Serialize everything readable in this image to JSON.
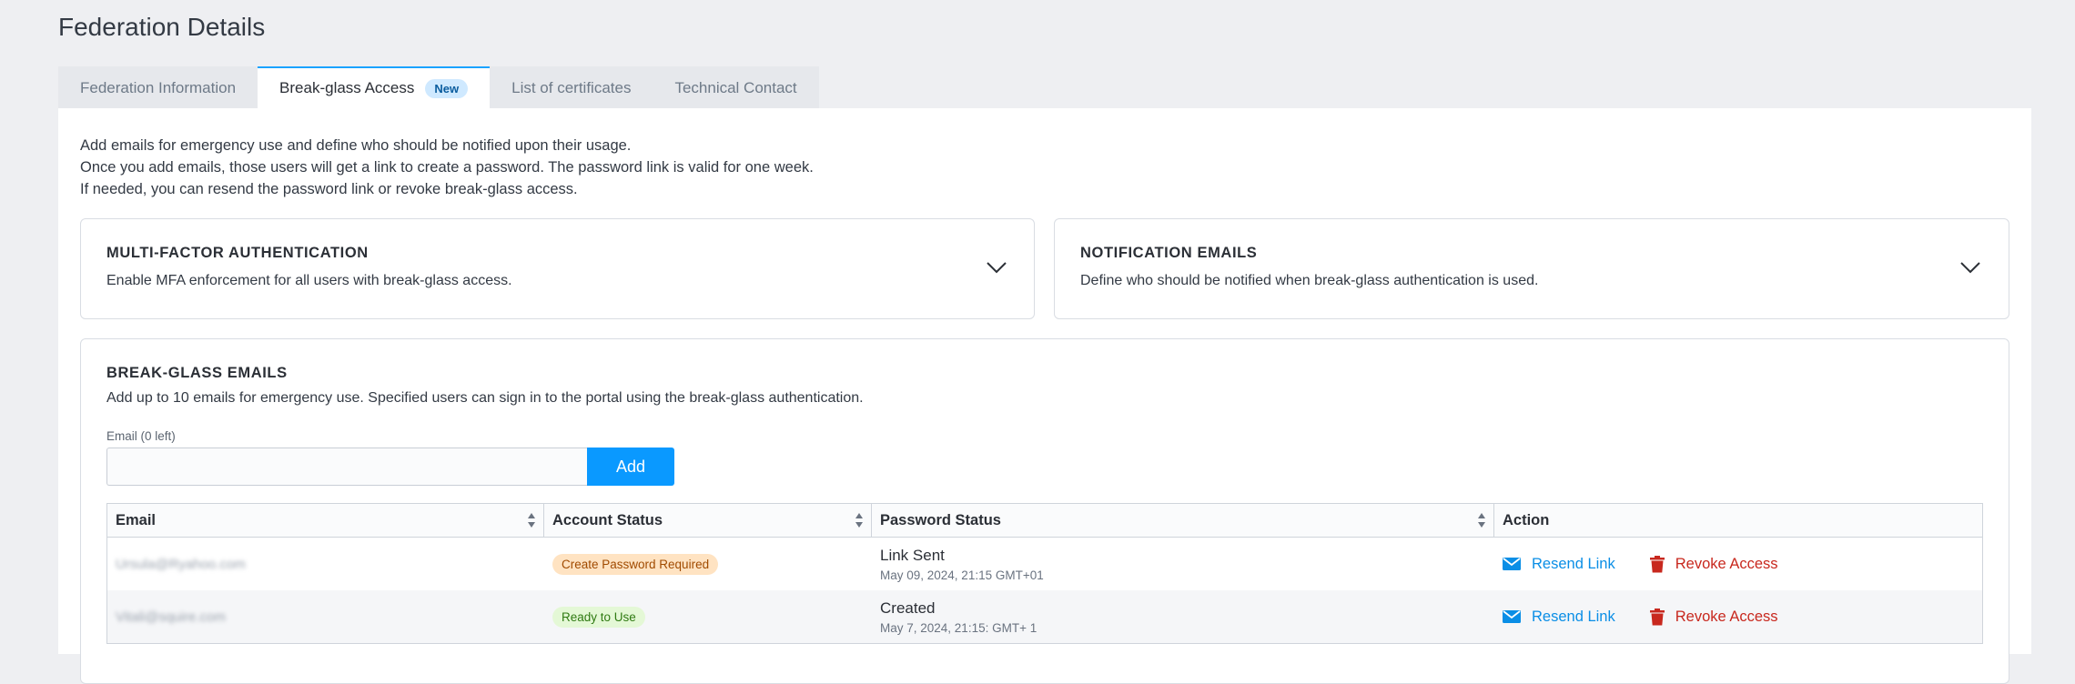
{
  "page": {
    "title": "Federation Details"
  },
  "tabs": [
    {
      "label": "Federation Information",
      "active": false
    },
    {
      "label": "Break-glass Access",
      "active": true,
      "badge": "New"
    },
    {
      "label": "List of certificates",
      "active": false
    },
    {
      "label": "Technical Contact",
      "active": false
    }
  ],
  "intro": {
    "line1": "Add emails for emergency use and define who should be notified upon their usage.",
    "line2": "Once you add emails, those users will get a link to create a password. The password link is valid for one week.",
    "line3": "If needed, you can resend the password link or revoke break-glass access."
  },
  "mfa_card": {
    "title": "MULTI-FACTOR AUTHENTICATION",
    "description": "Enable MFA enforcement for all users with break-glass access."
  },
  "notification_card": {
    "title": "NOTIFICATION EMAILS",
    "description": "Define who should be notified when break-glass authentication is used."
  },
  "breakglass": {
    "title": "BREAK-GLASS EMAILS",
    "description": "Add up to 10 emails for emergency use. Specified users can sign in to the portal using the break-glass authentication.",
    "email_label": "Email (0 left)",
    "email_value": "",
    "add_label": "Add"
  },
  "table": {
    "columns": [
      "Email",
      "Account Status",
      "Password Status",
      "Action"
    ],
    "rows": [
      {
        "email": "Ursula@Ryahoo.com",
        "account_status": "Create Password Required",
        "status_color": "#ffe3c2",
        "password_status": "Link Sent",
        "password_date": "May 09, 2024, 21:15 GMT+01",
        "resend_label": "Resend Link",
        "revoke_label": "Revoke Access"
      },
      {
        "email": "Vitali@squire.com",
        "account_status": "Ready to Use",
        "status_color": "#e4f8d6",
        "password_status": "Created",
        "password_date": "May 7, 2024, 21:15: GMT+ 1",
        "resend_label": "Resend Link",
        "revoke_label": "Revoke Access"
      }
    ]
  },
  "colors": {
    "accent": "#0a99ff",
    "danger": "#c8281e",
    "link": "#0a8ee6"
  }
}
